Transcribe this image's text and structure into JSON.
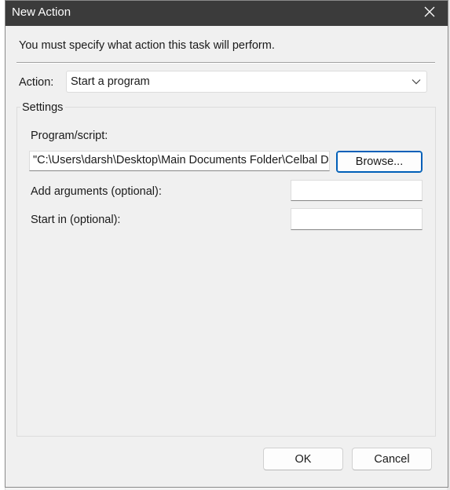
{
  "window": {
    "title": "New Action"
  },
  "instruction": "You must specify what action this task will perform.",
  "action": {
    "label": "Action:",
    "selected": "Start a program"
  },
  "settings": {
    "legend": "Settings",
    "program_label": "Program/script:",
    "program_value": "\"C:\\Users\\darsh\\Desktop\\Main Documents Folder\\Celbal D",
    "browse_label": "Browse...",
    "arguments_label": "Add arguments (optional):",
    "arguments_value": "",
    "start_in_label": "Start in (optional):",
    "start_in_value": ""
  },
  "buttons": {
    "ok_label": "OK",
    "cancel_label": "Cancel"
  },
  "colors": {
    "titlebar": "#3b3b3b",
    "accent": "#005fb8",
    "dialog_bg": "#f0f0f0"
  },
  "icons": {
    "close": "close-icon",
    "dropdown": "chevron-down-icon"
  }
}
